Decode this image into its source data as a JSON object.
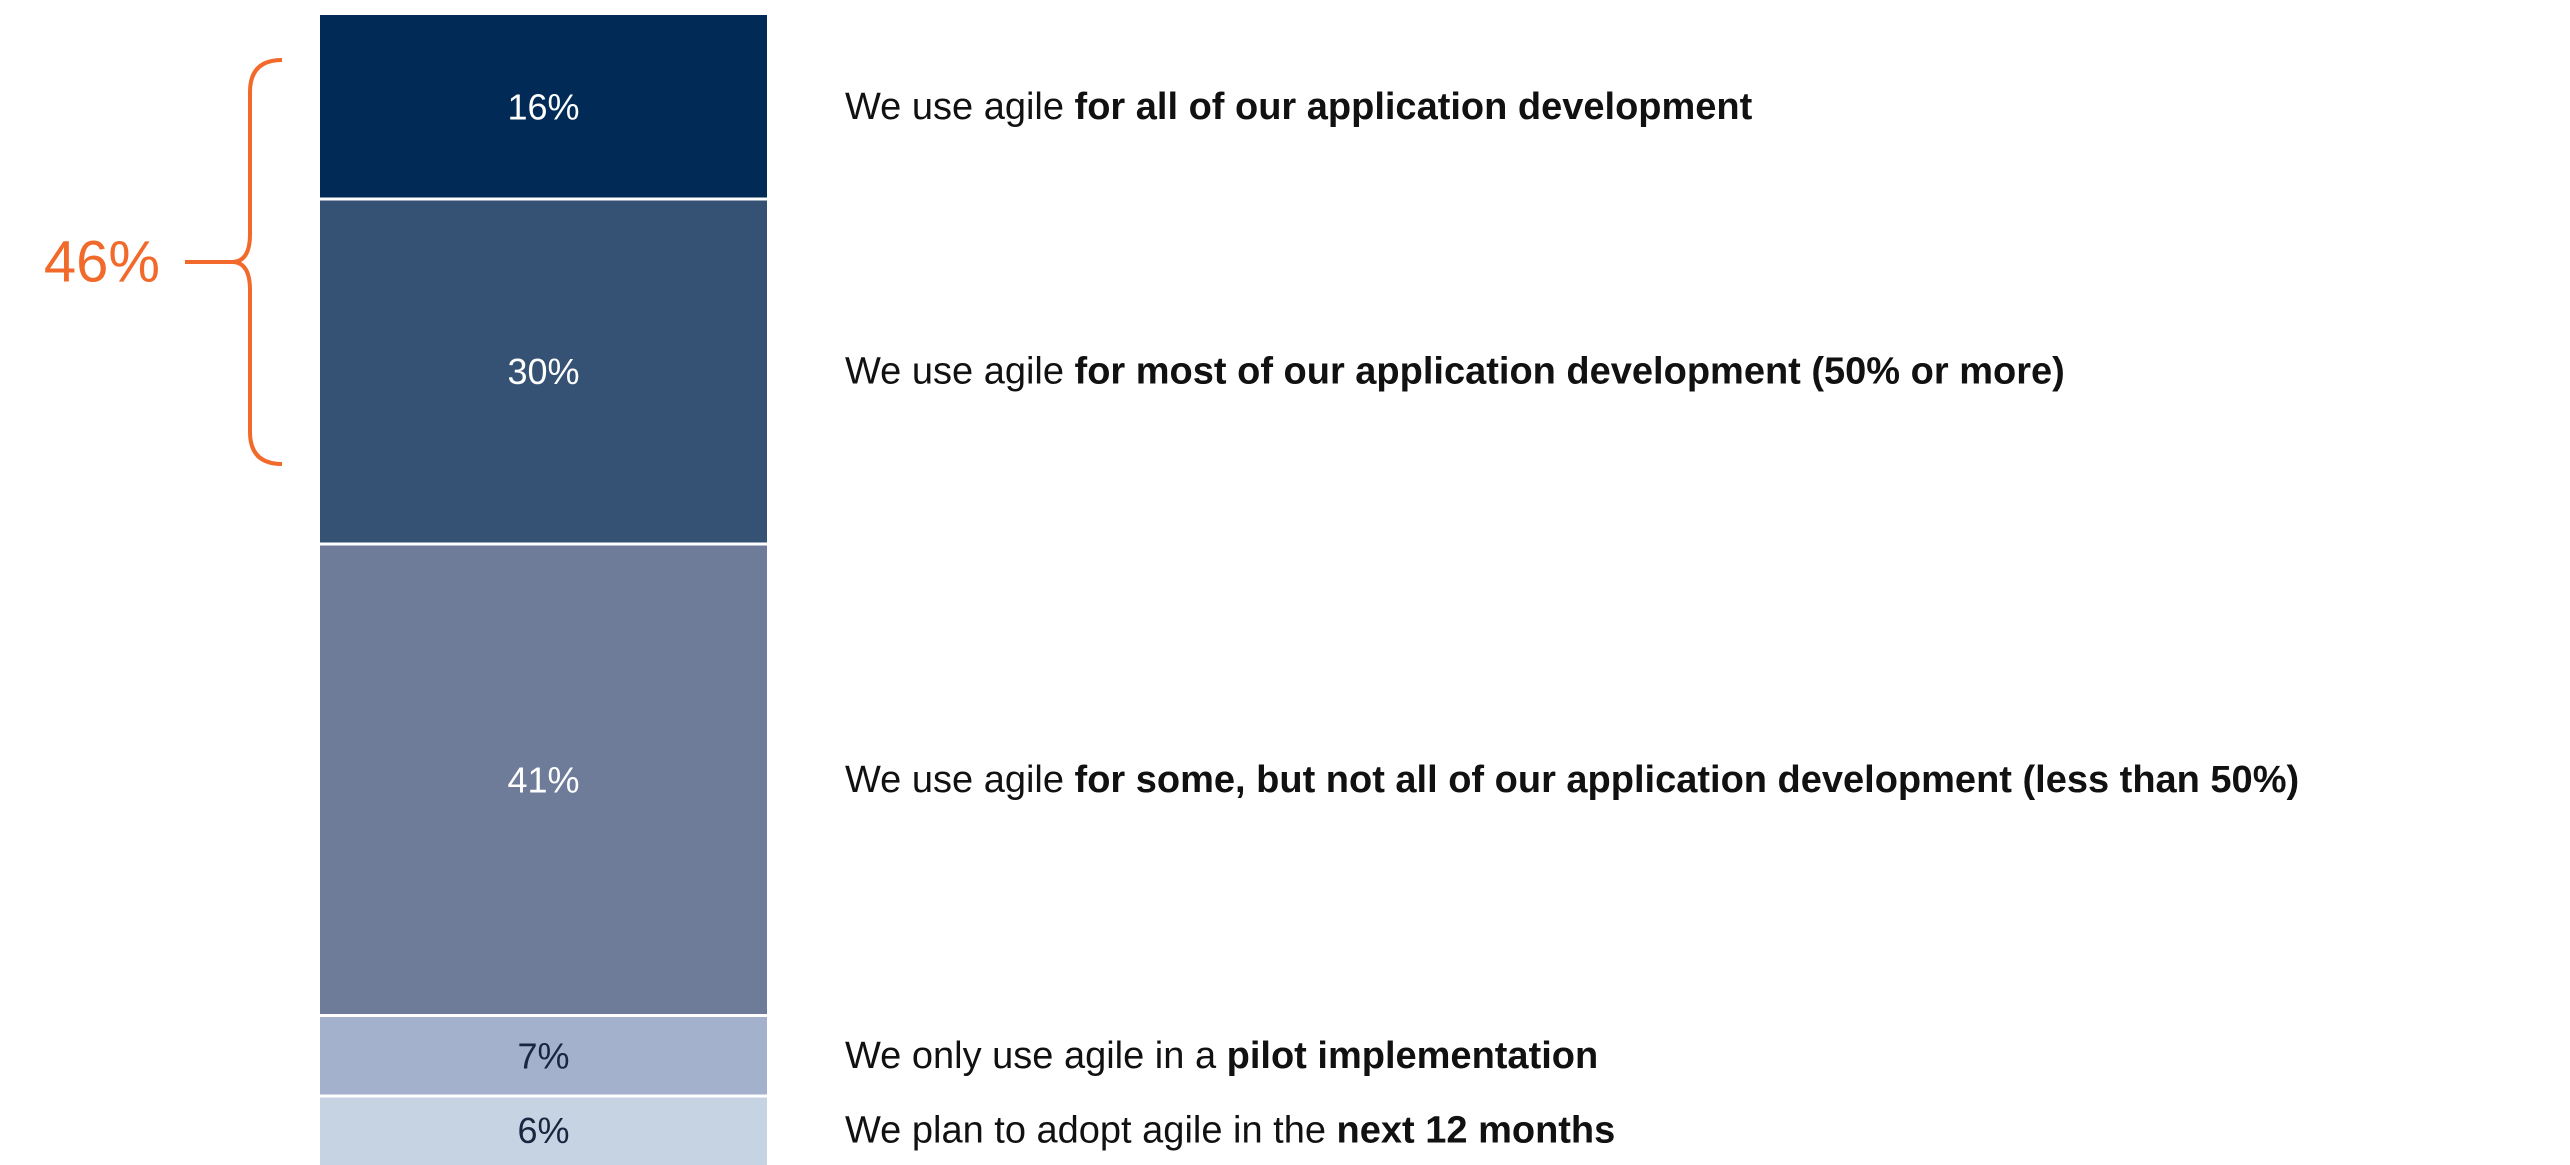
{
  "chart_data": {
    "type": "bar",
    "subtype": "stacked-100",
    "orientation": "vertical",
    "categories": [
      ""
    ],
    "series": [
      {
        "value": 16,
        "label": "16%",
        "color": "#022a57",
        "description": {
          "normal": "We use agile ",
          "bold": "for all of our application development",
          "suffix": ""
        }
      },
      {
        "value": 30,
        "label": "30%",
        "color": "#355275",
        "description": {
          "normal": "We use agile ",
          "bold": "for most of our application development (50% or more)",
          "suffix": ""
        }
      },
      {
        "value": 41,
        "label": "41%",
        "color": "#6e7c9a",
        "description": {
          "normal": "We use agile ",
          "bold": "for some, but not all of our application development (less than 50%)",
          "suffix": ""
        }
      },
      {
        "value": 7,
        "label": "7%",
        "color": "#a3b1cc",
        "description": {
          "normal": "We only use agile in a ",
          "bold": "pilot implementation",
          "suffix": ""
        }
      },
      {
        "value": 6,
        "label": "6%",
        "color": "#c5d3e3",
        "description": {
          "normal": "We plan to adopt agile in the ",
          "bold": "next 12 months",
          "suffix": ""
        }
      }
    ],
    "bracket": {
      "label": "46%",
      "spans_series": [
        0,
        1
      ],
      "color": "#f26a2b"
    },
    "title": "",
    "xlabel": "",
    "ylabel": "",
    "ylim": [
      0,
      100
    ],
    "grid": false,
    "legend": "none"
  }
}
